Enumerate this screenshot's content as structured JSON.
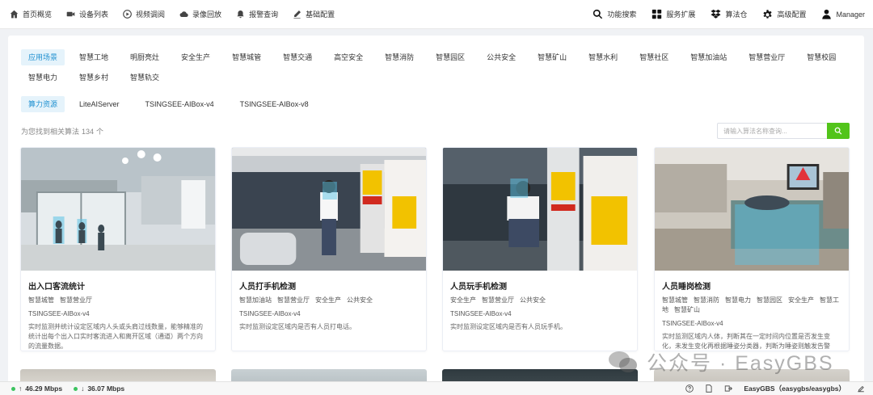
{
  "nav": {
    "left": [
      {
        "label": "首页概览",
        "icon": "home-icon"
      },
      {
        "label": "设备列表",
        "icon": "video-icon"
      },
      {
        "label": "视频调阅",
        "icon": "play-circle-icon"
      },
      {
        "label": "录像回放",
        "icon": "cloud-icon"
      },
      {
        "label": "报警查询",
        "icon": "bell-icon"
      },
      {
        "label": "基础配置",
        "icon": "pen-icon"
      }
    ],
    "right": [
      {
        "label": "功能搜索",
        "icon": "search-icon"
      },
      {
        "label": "服务扩展",
        "icon": "grid-icon"
      },
      {
        "label": "算法仓",
        "icon": "dropbox-icon"
      },
      {
        "label": "高级配置",
        "icon": "gear-icon"
      },
      {
        "label": "Manager",
        "icon": "user-icon"
      }
    ]
  },
  "scenes": [
    "应用场景",
    "智慧工地",
    "明厨亮灶",
    "安全生产",
    "智慧城管",
    "智慧交通",
    "高空安全",
    "智慧消防",
    "智慧园区",
    "公共安全",
    "智慧矿山",
    "智慧水利",
    "智慧社区",
    "智慧加油站",
    "智慧营业厅",
    "智慧校园",
    "智慧电力",
    "智慧乡村",
    "智慧轨交"
  ],
  "resources": [
    "算力资源",
    "LiteAIServer",
    "TSINGSEE-AIBox-v4",
    "TSINGSEE-AIBox-v8"
  ],
  "result": {
    "prefix": "为您找到相关算法",
    "count": "134",
    "suffix": "个"
  },
  "search": {
    "placeholder": "请输入算法名称查询..."
  },
  "cards": [
    {
      "title": "出入口客流统计",
      "tags": [
        "智慧城管",
        "智慧营业厅"
      ],
      "platform": "TSINGSEE-AIBox-v4",
      "desc": "实时监测并统计设定区域内人头或头肩过线数量，能够精准的统计出每个出入口实时客流进入和离开区域（通道）两个方向的流量数据。"
    },
    {
      "title": "人员打手机检测",
      "tags": [
        "智慧加油站",
        "智慧营业厅",
        "安全生产",
        "公共安全"
      ],
      "platform": "TSINGSEE-AIBox-v4",
      "desc": "实时监测设定区域内是否有人员打电话。"
    },
    {
      "title": "人员玩手机检测",
      "tags": [
        "安全生产",
        "智慧营业厅",
        "公共安全"
      ],
      "platform": "TSINGSEE-AIBox-v4",
      "desc": "实时监测设定区域内是否有人员玩手机。"
    },
    {
      "title": "人员睡岗检测",
      "tags": [
        "智慧城管",
        "智慧消防",
        "智慧电力",
        "智慧园区",
        "安全生产",
        "智慧工地",
        "智慧矿山"
      ],
      "platform": "TSINGSEE-AIBox-v4",
      "desc": "实时监测区域内人体，判断其在一定时间内位置是否发生变化，未发生变化再根据睡姿分类器，判断为睡姿则触发告警（睡姿包括趴在桌子上睡、靠在椅子上后仰睡、侧趴在桌子上睡、躺在椅子上睡等）。"
    }
  ],
  "watermark": "公众号 · EasyGBS",
  "status": {
    "up": "46.29 Mbps",
    "down": "36.07 Mbps",
    "app": "EasyGBS（easygbs/easygbs）"
  }
}
